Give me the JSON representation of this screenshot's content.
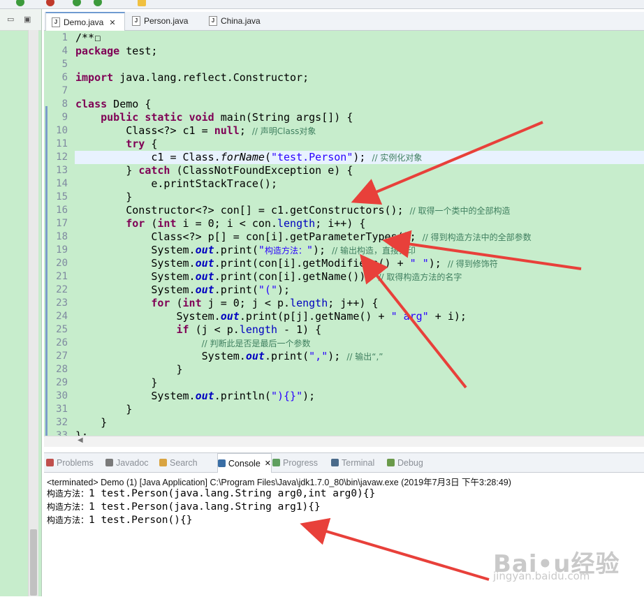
{
  "tabs": [
    {
      "label": "Demo.java",
      "active": true,
      "closable": true
    },
    {
      "label": "Person.java",
      "active": false,
      "closable": false
    },
    {
      "label": "China.java",
      "active": false,
      "closable": false
    }
  ],
  "code_lines": [
    {
      "n": "1",
      "html": "/**☐"
    },
    {
      "n": "4",
      "html": "<span class=\"kw\">package</span> test;"
    },
    {
      "n": "5",
      "html": ""
    },
    {
      "n": "6",
      "html": "<span class=\"kw\">import</span> java.lang.reflect.Constructor;"
    },
    {
      "n": "7",
      "html": ""
    },
    {
      "n": "8",
      "html": "<span class=\"kw\">class</span> Demo {"
    },
    {
      "n": "9",
      "html": "    <span class=\"kw\">public</span> <span class=\"kw\">static</span> <span class=\"kw\">void</span> main(String args[]) {"
    },
    {
      "n": "10",
      "html": "        Class&lt;?&gt; c1 = <span class=\"kw\">null</span>; <span class=\"cm\">// 声明Class对象</span>"
    },
    {
      "n": "11",
      "html": "        <span class=\"kw\">try</span> {"
    },
    {
      "n": "12",
      "html": "            c1 = Class.<span class=\"ital\">forName</span>(<span class=\"str\">\"test.Person\"</span>); <span class=\"cm\">// 实例化对象</span>"
    },
    {
      "n": "13",
      "html": "        } <span class=\"kw\">catch</span> (ClassNotFoundException e) {"
    },
    {
      "n": "14",
      "html": "            e.printStackTrace();"
    },
    {
      "n": "15",
      "html": "        }"
    },
    {
      "n": "16",
      "html": "        Constructor&lt;?&gt; con[] = c1.getConstructors(); <span class=\"cm\">// 取得一个类中的全部构造</span>"
    },
    {
      "n": "17",
      "html": "        <span class=\"kw\">for</span> (<span class=\"kw\">int</span> i = 0; i &lt; con.<span class=\"fld\">length</span>; i++) {"
    },
    {
      "n": "18",
      "html": "            Class&lt;?&gt; p[] = con[i].getParameterTypes(); <span class=\"cm\">// 得到构造方法中的全部参数</span>"
    },
    {
      "n": "19",
      "html": "            System.<span class=\"sfld\">out</span>.print(<span class=\"str\">\"<span class=\"cm\" style=\"color:#2a00ff\">构造方法：</span>\"</span>); <span class=\"cm\">// 输出构造，直接打印</span>"
    },
    {
      "n": "20",
      "html": "            System.<span class=\"sfld\">out</span>.print(con[i].getModifiers() + <span class=\"str\">\" \"</span>); <span class=\"cm\">// 得到修饰符</span>"
    },
    {
      "n": "21",
      "html": "            System.<span class=\"sfld\">out</span>.print(con[i].getName()); <span class=\"cm\">// 取得构造方法的名字</span>"
    },
    {
      "n": "22",
      "html": "            System.<span class=\"sfld\">out</span>.print(<span class=\"str\">\"(\"</span>);"
    },
    {
      "n": "23",
      "html": "            <span class=\"kw\">for</span> (<span class=\"kw\">int</span> j = 0; j &lt; p.<span class=\"fld\">length</span>; j++) {"
    },
    {
      "n": "24",
      "html": "                System.<span class=\"sfld\">out</span>.print(p[j].getName() + <span class=\"str\">\" arg\"</span> + i);"
    },
    {
      "n": "25",
      "html": "                <span class=\"kw\">if</span> (j &lt; p.<span class=\"fld\">length</span> - 1) {"
    },
    {
      "n": "26",
      "html": "                    <span class=\"cm\">// 判断此是否是最后一个参数</span>"
    },
    {
      "n": "27",
      "html": "                    System.<span class=\"sfld\">out</span>.print(<span class=\"str\">\",\"</span>); <span class=\"cm\">// 输出“,”</span>"
    },
    {
      "n": "28",
      "html": "                }"
    },
    {
      "n": "29",
      "html": "            }"
    },
    {
      "n": "30",
      "html": "            System.<span class=\"sfld\">out</span>.println(<span class=\"str\">\"){}\"</span>);"
    },
    {
      "n": "31",
      "html": "        }"
    },
    {
      "n": "32",
      "html": "    }"
    },
    {
      "n": "33",
      "html": "};"
    }
  ],
  "console_tabs": [
    {
      "label": "Problems",
      "icon": "problems-icon",
      "color": "#c0504d"
    },
    {
      "label": "Javadoc",
      "icon": "javadoc-icon",
      "color": "#7a7a7a"
    },
    {
      "label": "Search",
      "icon": "search-icon",
      "color": "#d9a441"
    },
    {
      "label": "Console",
      "icon": "console-icon",
      "color": "#3a6ea5",
      "active": true
    },
    {
      "label": "Progress",
      "icon": "progress-icon",
      "color": "#5f9f5f"
    },
    {
      "label": "Terminal",
      "icon": "terminal-icon",
      "color": "#4a6a8a"
    },
    {
      "label": "Debug",
      "icon": "debug-icon",
      "color": "#6a9a4a"
    }
  ],
  "console": {
    "status": "<terminated> Demo (1) [Java Application] C:\\Program Files\\Java\\jdk1.7.0_80\\bin\\javaw.exe (2019年7月3日 下午3:28:49)",
    "lines": [
      {
        "prefix": "构造方法：",
        "text": "1 test.Person(java.lang.String arg0,int arg0){}"
      },
      {
        "prefix": "构造方法：",
        "text": "1 test.Person(java.lang.String arg1){}"
      },
      {
        "prefix": "构造方法：",
        "text": "1 test.Person(){}"
      }
    ]
  },
  "watermark": {
    "logo": "Bai•u经验",
    "url": "jingyan.baidu.com"
  },
  "colors": {
    "editor_bg": "#c7edcc",
    "arrow": "#e8403a",
    "keyword": "#7f0055",
    "string": "#2a00ff"
  }
}
